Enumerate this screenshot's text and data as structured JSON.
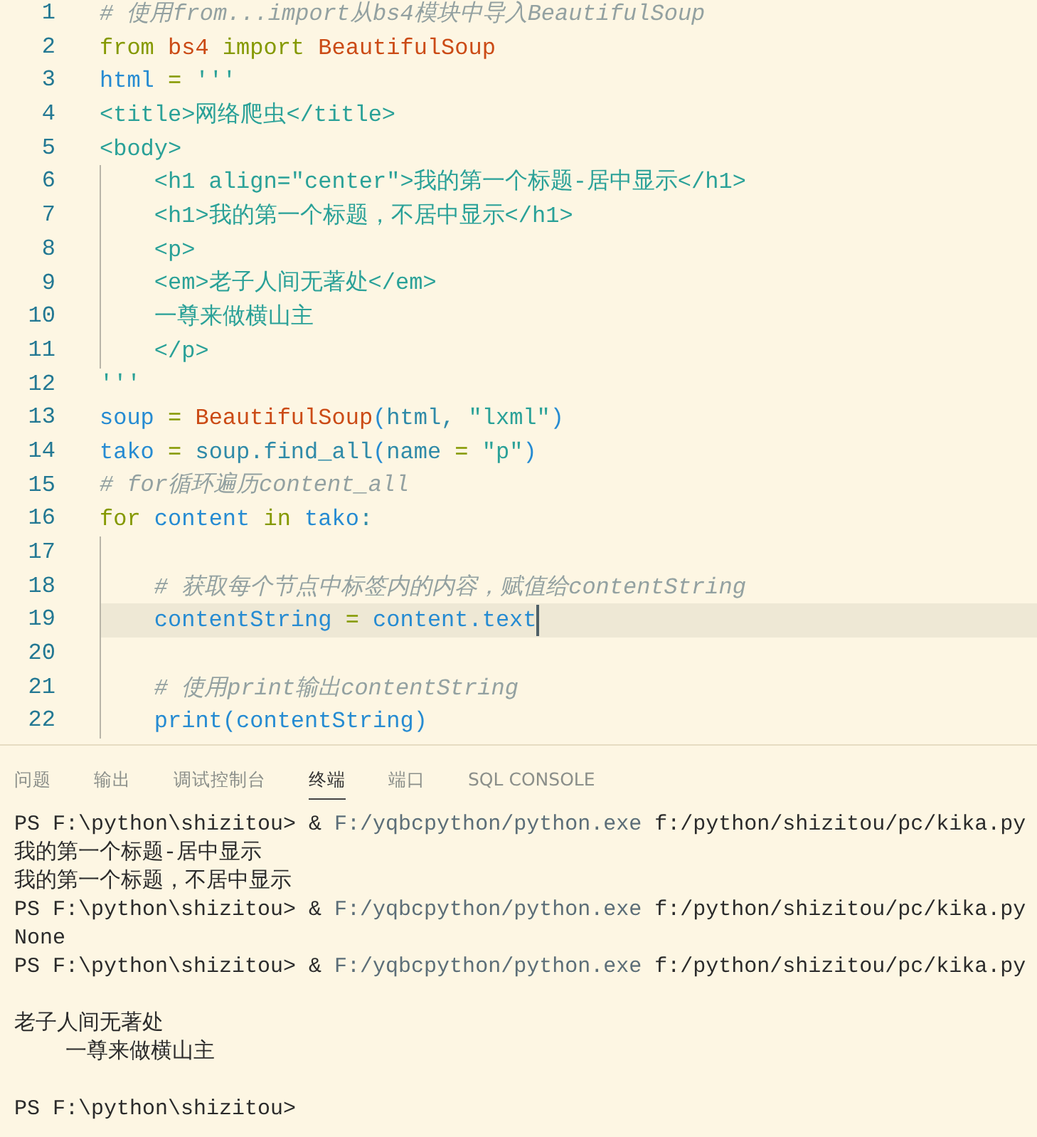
{
  "editor": {
    "lines": [
      {
        "number": "1",
        "current": false,
        "tokens": [
          {
            "text": "# 使用from...import从bs4模块中导入BeautifulSoup",
            "kind": "comment"
          }
        ]
      },
      {
        "number": "2",
        "current": false,
        "tokens": [
          {
            "text": "from ",
            "kind": "keyword"
          },
          {
            "text": "bs4 ",
            "kind": "module"
          },
          {
            "text": "import ",
            "kind": "keyword"
          },
          {
            "text": "BeautifulSoup",
            "kind": "module"
          }
        ]
      },
      {
        "number": "3",
        "current": false,
        "tokens": [
          {
            "text": "html",
            "kind": "variable"
          },
          {
            "text": " = ",
            "kind": "operator"
          },
          {
            "text": "'''",
            "kind": "string"
          }
        ]
      },
      {
        "number": "4",
        "current": false,
        "tokens": [
          {
            "text": "<title>网络爬虫</title>",
            "kind": "string"
          }
        ]
      },
      {
        "number": "5",
        "current": false,
        "tokens": [
          {
            "text": "<body>",
            "kind": "string"
          }
        ],
        "children": [
          {
            "number": "6",
            "current": false,
            "tokens": [
              {
                "text": "<h1 align=\"center\">我的第一个标题-居中显示</h1>",
                "kind": "string"
              }
            ]
          },
          {
            "number": "7",
            "current": false,
            "tokens": [
              {
                "text": "<h1>我的第一个标题，不居中显示</h1>",
                "kind": "string"
              }
            ]
          },
          {
            "number": "8",
            "current": false,
            "tokens": [
              {
                "text": "<p>",
                "kind": "string"
              }
            ]
          },
          {
            "number": "9",
            "current": false,
            "tokens": [
              {
                "text": "<em>老子人间无著处</em>",
                "kind": "string"
              }
            ]
          },
          {
            "number": "10",
            "current": false,
            "tokens": [
              {
                "text": "一尊来做横山主",
                "kind": "string"
              }
            ]
          },
          {
            "number": "11",
            "current": false,
            "tokens": [
              {
                "text": "</p>",
                "kind": "string"
              }
            ]
          }
        ]
      },
      {
        "number": "12",
        "current": false,
        "tokens": [
          {
            "text": "'''",
            "kind": "string"
          }
        ]
      },
      {
        "number": "13",
        "current": false,
        "tokens": [
          {
            "text": "soup",
            "kind": "variable"
          },
          {
            "text": " = ",
            "kind": "operator"
          },
          {
            "text": "BeautifulSoup",
            "kind": "module"
          },
          {
            "text": "(",
            "kind": "bracket"
          },
          {
            "text": "html, ",
            "kind": "param"
          },
          {
            "text": "\"lxml\"",
            "kind": "string"
          },
          {
            "text": ")",
            "kind": "bracket"
          }
        ]
      },
      {
        "number": "14",
        "current": false,
        "tokens": [
          {
            "text": "tako",
            "kind": "variable"
          },
          {
            "text": " = ",
            "kind": "operator"
          },
          {
            "text": "soup.find_all",
            "kind": "param"
          },
          {
            "text": "(",
            "kind": "bracket"
          },
          {
            "text": "name",
            "kind": "param"
          },
          {
            "text": " = ",
            "kind": "operator"
          },
          {
            "text": "\"p\"",
            "kind": "string"
          },
          {
            "text": ")",
            "kind": "bracket"
          }
        ]
      },
      {
        "number": "15",
        "current": false,
        "tokens": [
          {
            "text": "# for循环遍历content_all",
            "kind": "comment"
          }
        ]
      },
      {
        "number": "16",
        "current": false,
        "tokens": [
          {
            "text": "for ",
            "kind": "keyword"
          },
          {
            "text": "content ",
            "kind": "variable"
          },
          {
            "text": "in ",
            "kind": "keyword"
          },
          {
            "text": "tako",
            "kind": "variable"
          },
          {
            "text": ":",
            "kind": "plain"
          }
        ],
        "children": [
          {
            "number": "17",
            "current": false
          },
          {
            "number": "18",
            "current": false,
            "tokens": [
              {
                "text": "# 获取每个节点中标签内的内容，赋值给contentString",
                "kind": "comment"
              }
            ]
          },
          {
            "number": "19",
            "current": true,
            "tokens": [
              {
                "text": "contentString",
                "kind": "variable"
              },
              {
                "text": " = ",
                "kind": "operator"
              },
              {
                "text": "content.text",
                "kind": "variable"
              }
            ]
          },
          {
            "number": "20",
            "current": false
          },
          {
            "number": "21",
            "current": false,
            "tokens": [
              {
                "text": "# 使用print输出contentString",
                "kind": "comment"
              }
            ]
          },
          {
            "number": "22",
            "current": false,
            "tokens": [
              {
                "text": "print",
                "kind": "function"
              },
              {
                "text": "(",
                "kind": "bracket"
              },
              {
                "text": "contentString",
                "kind": "variable"
              },
              {
                "text": ")",
                "kind": "bracket"
              }
            ]
          }
        ]
      }
    ]
  },
  "panel": {
    "tabs": [
      {
        "label": "问题",
        "selected": false
      },
      {
        "label": "输出",
        "selected": false
      },
      {
        "label": "调试控制台",
        "selected": false
      },
      {
        "label": "终端",
        "selected": true
      },
      {
        "label": "端口",
        "selected": false
      },
      {
        "label": "SQL CONSOLE",
        "selected": false
      }
    ]
  },
  "terminal": {
    "blocks": [
      {
        "lines": [
          {
            "segments": [
              {
                "text": "PS F:\\python\\shizitou> & ",
                "kind": "plain"
              },
              {
                "text": "F:/yqbcpython/python.exe",
                "kind": "dim"
              },
              {
                "text": " f:/python/shizitou/pc/kika.py",
                "kind": "plain"
              }
            ]
          },
          {
            "segments": [
              {
                "text": "我的第一个标题-居中显示",
                "kind": "plain"
              }
            ]
          },
          {
            "segments": [
              {
                "text": "我的第一个标题，不居中显示",
                "kind": "plain"
              }
            ]
          },
          {
            "segments": [
              {
                "text": "PS F:\\python\\shizitou> & ",
                "kind": "plain"
              },
              {
                "text": "F:/yqbcpython/python.exe",
                "kind": "dim"
              },
              {
                "text": " f:/python/shizitou/pc/kika.py",
                "kind": "plain"
              }
            ]
          },
          {
            "segments": [
              {
                "text": "None",
                "kind": "plain"
              }
            ]
          },
          {
            "segments": [
              {
                "text": "PS F:\\python\\shizitou> & ",
                "kind": "plain"
              },
              {
                "text": "F:/yqbcpython/python.exe",
                "kind": "dim"
              },
              {
                "text": " f:/python/shizitou/pc/kika.py",
                "kind": "plain"
              }
            ]
          }
        ]
      },
      {
        "lines": [
          {
            "segments": [
              {
                "text": "老子人间无著处",
                "kind": "plain"
              }
            ],
            "children": [
              {
                "segments": [
                  {
                    "text": "一尊来做横山主",
                    "kind": "plain"
                  }
                ]
              }
            ]
          }
        ]
      },
      {
        "lines": [
          {
            "segments": [
              {
                "text": "PS F:\\python\\shizitou>",
                "kind": "plain"
              }
            ]
          }
        ]
      }
    ]
  }
}
